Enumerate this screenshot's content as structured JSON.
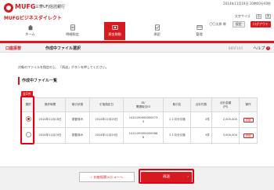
{
  "header": {
    "logo_text": "MUFG",
    "bank_name": "三菱UFJ信託銀行",
    "service_name": "MUFGビジネスダイレクト",
    "datetime": "2014年11月19日 10時00分00秒",
    "font_size_label": "文字サイズ",
    "size_buttons": [
      "小",
      "大"
    ],
    "user_name": "〇〇太郎 様",
    "settings_button": "設定",
    "logout_button": "ログアウト"
  },
  "nav": {
    "items": [
      {
        "label": "ホーム",
        "icon": "home-icon",
        "active": false
      },
      {
        "label": "明細照会",
        "icon": "document-icon",
        "active": false
      },
      {
        "label": "資金移動",
        "icon": "transfer-icon",
        "active": true
      },
      {
        "label": "承認",
        "icon": "approve-icon",
        "active": false
      },
      {
        "label": "管理",
        "icon": "manage-icon",
        "active": false
      }
    ]
  },
  "subbar": {
    "breadcrumb": "口座振替",
    "title": "作成中ファイル選択",
    "screen_id": "BKRF104",
    "help_label": "ヘルプ"
  },
  "instruction": "対象のファイルを指定の上、「再送」ボタンを押してください。",
  "section_title": "作成中ファイル一覧",
  "badge": "全2件",
  "table": {
    "headers": [
      "選択",
      "操作時間",
      "取引状態",
      "引落指定日",
      "ID/\n関連取引ID",
      "取引名",
      "合計件数",
      "合計金額\n(円)",
      "操作"
    ],
    "rows": [
      {
        "selected": true,
        "time": "2014年11月18日",
        "status": "振替済み",
        "date": "2014年11月20日",
        "id": "1411190000000073\n3",
        "name": "１１月分引落",
        "count": "2件",
        "amount": "2,000,000",
        "action": "詳細"
      },
      {
        "selected": false,
        "time": "2014年11月19日",
        "status": "振替済み",
        "date": "2014年11月20日",
        "id": "1411190000000068\n8",
        "name": "１１月分引落",
        "count": "3件",
        "amount": "3,000,000",
        "action": "詳細"
      }
    ]
  },
  "footer": {
    "back_button": "口座振替メニューへ",
    "next_button": "再送"
  },
  "colors": {
    "accent": "#d71920",
    "highlight": "#e60012"
  }
}
